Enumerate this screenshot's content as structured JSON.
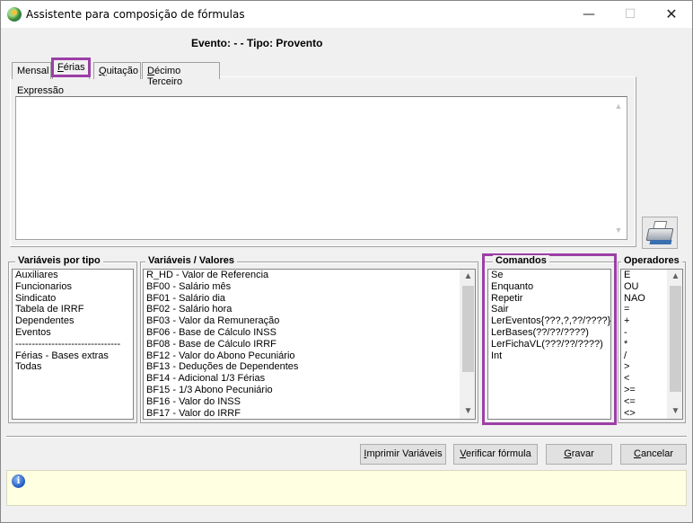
{
  "window": {
    "title": "Assistente para composição de fórmulas",
    "minimize_glyph": "—",
    "maximize_glyph": "☐",
    "close_glyph": "✕"
  },
  "event_label": "Evento:  -  - Tipo: Provento",
  "tabs": [
    {
      "label": "Mensal",
      "mnemonic": "",
      "rest": "Mensal",
      "active": false
    },
    {
      "label": "Férias",
      "mnemonic": "F",
      "rest": "érias",
      "active": true
    },
    {
      "label": "Quitação",
      "mnemonic": "Q",
      "rest": "uitação",
      "active": false
    },
    {
      "label": "Décimo Terceiro",
      "mnemonic": "D",
      "rest": "écimo Terceiro",
      "active": false
    }
  ],
  "expression": {
    "label": "Expressão",
    "value": ""
  },
  "panels": {
    "variables_by_type": {
      "title": "Variáveis por tipo",
      "items": [
        "Auxiliares",
        "Funcionarios",
        "Sindicato",
        "Tabela de IRRF",
        "Dependentes",
        "Eventos",
        "--------------------------------",
        "Férias - Bases extras",
        "Todas"
      ]
    },
    "variables_values": {
      "title": "Variáveis / Valores",
      "items": [
        "R_HD - Valor de Referencia",
        "BF00 - Salário mês",
        "BF01 - Salário dia",
        "BF02 - Salário hora",
        "BF03 - Valor da Remuneração",
        "BF06 - Base de Cálculo INSS",
        "BF08 - Base de Cálculo IRRF",
        "BF12 - Valor do Abono Pecuniário",
        "BF13 - Deduções de Dependentes",
        "BF14 - Adicional 1/3 Férias",
        "BF15 - 1/3 Abono Pecuniário",
        "BF16 - Valor do INSS",
        "BF17 - Valor do IRRF"
      ]
    },
    "commands": {
      "title": "Comandos",
      "items": [
        "Se",
        "Enquanto",
        "Repetir",
        "Sair",
        "LerEventos{???,?,??/????}",
        "LerBases(??/??/????)",
        "LerFichaVL(???/??/????)",
        "Int"
      ]
    },
    "operators": {
      "title": "Operadores",
      "items": [
        "E",
        "OU",
        "NAO",
        "=",
        "+",
        "-",
        "*",
        "/",
        ">",
        "<",
        ">=",
        "<=",
        "<>"
      ]
    }
  },
  "buttons": {
    "print_variables": {
      "pre": "",
      "mnemonic": "I",
      "rest": "mprimir Variáveis"
    },
    "verify_formula": {
      "pre": "",
      "mnemonic": "V",
      "rest": "erificar fórmula"
    },
    "save": {
      "pre": "",
      "mnemonic": "G",
      "rest": "ravar"
    },
    "cancel": {
      "pre": "",
      "mnemonic": "C",
      "rest": "ancelar"
    }
  },
  "status": {
    "message": ""
  },
  "colors": {
    "highlight": "#9c3fa6",
    "status_background": "#ffffe1",
    "window_background": "#f0f0f0"
  }
}
